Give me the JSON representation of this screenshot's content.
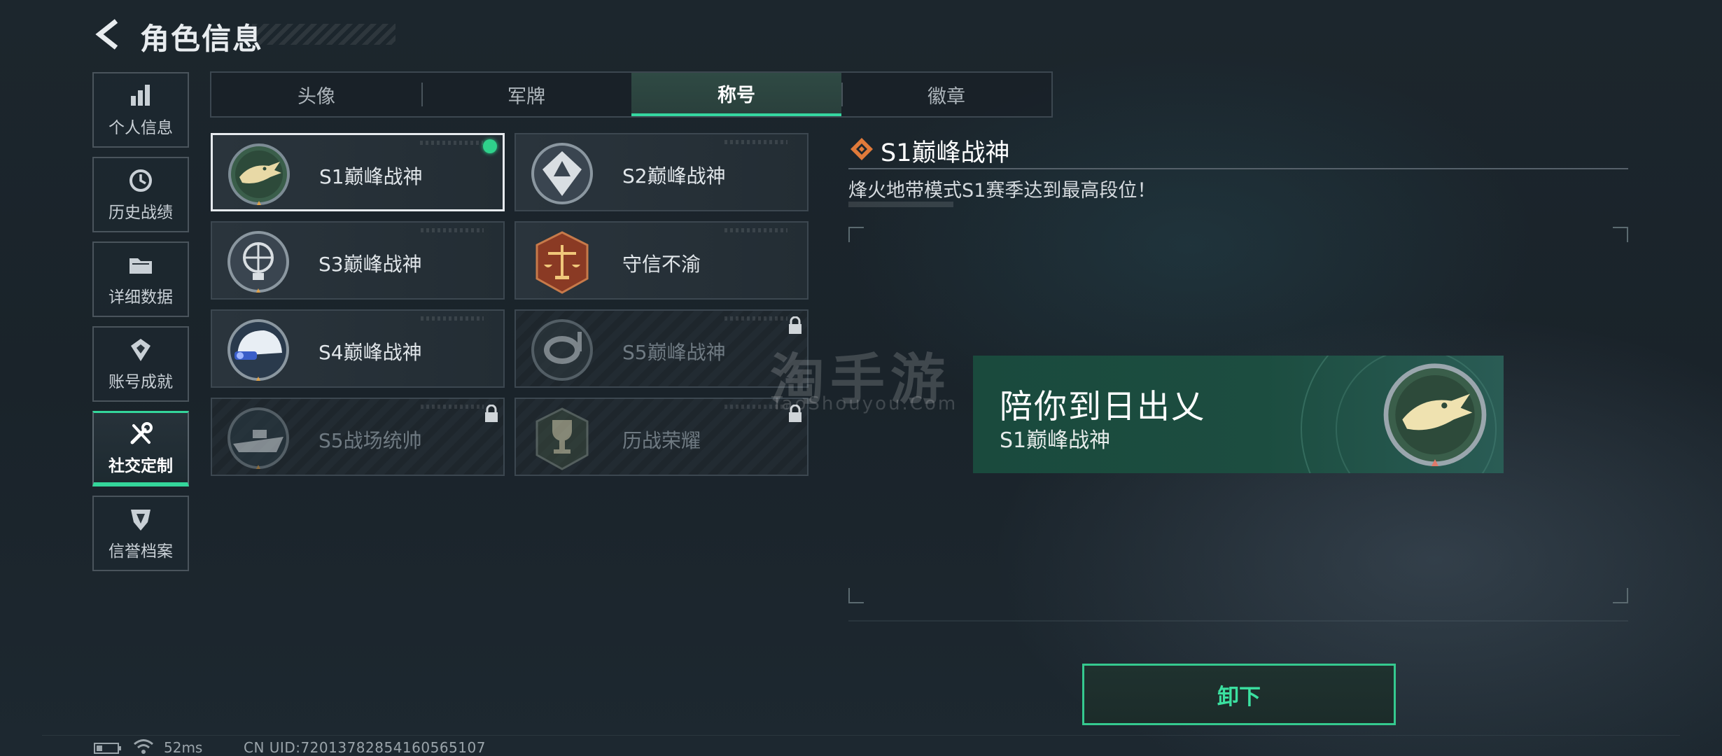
{
  "header": {
    "title": "角色信息"
  },
  "nav": [
    {
      "label": "个人信息",
      "icon": "bar-chart-icon"
    },
    {
      "label": "历史战绩",
      "icon": "clock-icon"
    },
    {
      "label": "详细数据",
      "icon": "folder-icon"
    },
    {
      "label": "账号成就",
      "icon": "medal-icon"
    },
    {
      "label": "社交定制",
      "icon": "tools-icon",
      "active": true
    },
    {
      "label": "信誉档案",
      "icon": "shield-icon"
    }
  ],
  "tabs": [
    {
      "label": "头像"
    },
    {
      "label": "军牌"
    },
    {
      "label": "称号",
      "active": true
    },
    {
      "label": "徽章"
    }
  ],
  "titles": [
    {
      "name": "S1巅峰战神",
      "locked": false,
      "selected": true,
      "equipped": true
    },
    {
      "name": "S2巅峰战神",
      "locked": false
    },
    {
      "name": "S3巅峰战神",
      "locked": false
    },
    {
      "name": "守信不渝",
      "locked": false
    },
    {
      "name": "S4巅峰战神",
      "locked": false
    },
    {
      "name": "S5巅峰战神",
      "locked": true
    },
    {
      "name": "S5战场统帅",
      "locked": true
    },
    {
      "name": "历战荣耀",
      "locked": true
    }
  ],
  "detail": {
    "title": "S1巅峰战神",
    "description": "烽火地带模式S1赛季达到最高段位！"
  },
  "nameplate": {
    "player_name": "陪你到日出乂",
    "title": "S1巅峰战神"
  },
  "action": {
    "unequip_label": "卸下"
  },
  "watermark": {
    "main": "淘手游",
    "sub": "TaoShouyou.Com"
  },
  "footer": {
    "ping": "52ms",
    "uid": "CN UID:72013782854160565107"
  },
  "colors": {
    "accent": "#35d6a0",
    "equipped_dot": "#2fd18b",
    "nameplate_bg": "#1a4a3d",
    "background": "#1c262d"
  }
}
